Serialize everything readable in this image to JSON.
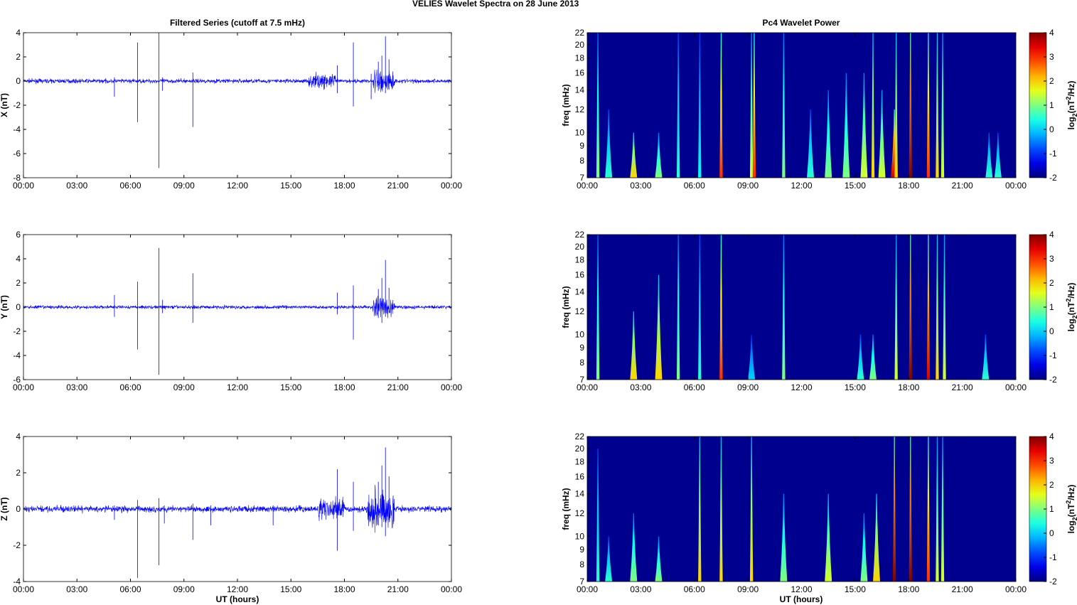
{
  "title": "VELIES Wavelet Spectra on 28 June      2013",
  "colors": {
    "series": "#0000ff",
    "background": "#00008f"
  },
  "chart_data": [
    {
      "type": "line",
      "title": "Filtered Series (cutoff at 7.5 mHz)",
      "panels": [
        {
          "ylabel": "X (nT)",
          "ylim": [
            -8,
            4
          ],
          "yticks": [
            -8,
            -6,
            -4,
            -2,
            0,
            2,
            4
          ],
          "noise": 0.12,
          "spikes": [
            [
              5.1,
              0.3,
              -1.3
            ],
            [
              6.4,
              3.2,
              -3.4
            ],
            [
              7.6,
              4.0,
              -7.2
            ],
            [
              7.8,
              0.3,
              -0.8
            ],
            [
              9.5,
              0.7,
              -3.8
            ],
            [
              17.6,
              1.3,
              -1.0
            ],
            [
              18.5,
              3.2,
              -2.1
            ],
            [
              19.5,
              0.6,
              -1.5
            ],
            [
              19.9,
              1.6,
              -0.8
            ],
            [
              20.1,
              2.1,
              -0.6
            ],
            [
              20.3,
              3.7,
              -1.0
            ],
            [
              20.5,
              1.8,
              -0.7
            ]
          ],
          "burst": [
            [
              16.0,
              17.5,
              0.3
            ],
            [
              19.6,
              20.8,
              0.6
            ]
          ]
        },
        {
          "ylabel": "Y (nT)",
          "ylim": [
            -6,
            6
          ],
          "yticks": [
            -6,
            -4,
            -2,
            0,
            2,
            4,
            6
          ],
          "noise": 0.1,
          "spikes": [
            [
              5.1,
              1.0,
              -0.8
            ],
            [
              6.4,
              2.1,
              -3.5
            ],
            [
              7.6,
              4.9,
              -5.6
            ],
            [
              7.8,
              0.6,
              -0.5
            ],
            [
              9.5,
              2.8,
              -1.3
            ],
            [
              17.6,
              1.2,
              -0.6
            ],
            [
              18.5,
              1.8,
              -2.7
            ],
            [
              19.9,
              1.5,
              -0.9
            ],
            [
              20.1,
              2.4,
              -1.3
            ],
            [
              20.3,
              3.9,
              -0.8
            ],
            [
              20.5,
              1.6,
              -0.5
            ]
          ],
          "burst": [
            [
              19.6,
              20.8,
              0.5
            ]
          ]
        },
        {
          "ylabel": "Z (nT)",
          "ylim": [
            -4,
            4
          ],
          "yticks": [
            -4,
            -2,
            0,
            2,
            4
          ],
          "noise": 0.12,
          "spikes": [
            [
              5.1,
              0.2,
              -0.6
            ],
            [
              6.4,
              0.5,
              -3.8
            ],
            [
              7.6,
              0.6,
              -3.1
            ],
            [
              7.9,
              0.2,
              -0.8
            ],
            [
              9.5,
              0.3,
              -1.7
            ],
            [
              10.5,
              0.2,
              -0.9
            ],
            [
              14,
              0.2,
              -0.9
            ],
            [
              17.6,
              2.2,
              -2.3
            ],
            [
              18.5,
              1.5,
              -1.2
            ],
            [
              19.9,
              1.5,
              -0.9
            ],
            [
              20.1,
              2.4,
              -1.0
            ],
            [
              20.3,
              3.4,
              -1.5
            ],
            [
              20.5,
              1.8,
              -0.6
            ]
          ],
          "burst": [
            [
              16.5,
              18.0,
              0.3
            ],
            [
              19.3,
              20.8,
              0.6
            ]
          ]
        }
      ],
      "xlabel": "UT (hours)",
      "xlim": [
        0,
        24
      ],
      "xticks": [
        "00:00",
        "03:00",
        "06:00",
        "09:00",
        "12:00",
        "15:00",
        "18:00",
        "21:00",
        "00:00"
      ]
    },
    {
      "type": "heatmap",
      "title": "Pc4 Wavelet Power",
      "ylabel": "freq (mHz)",
      "ylim": [
        7,
        22
      ],
      "yticks": [
        7,
        8,
        9,
        10,
        12,
        14,
        16,
        18,
        20,
        22
      ],
      "xlabel": "UT (hours)",
      "xticks": [
        "00:00",
        "03:00",
        "06:00",
        "09:00",
        "12:00",
        "15:00",
        "18:00",
        "21:00",
        "00:00"
      ],
      "colorbar": {
        "label": "log2(nT2/Hz)",
        "label_main": "log",
        "label_sub": "2",
        "label_rest": "(nT",
        "label_sup": "2",
        "label_end": "/Hz)",
        "range": [
          -2,
          4
        ],
        "ticks": [
          -2,
          -1,
          0,
          1,
          2,
          3,
          4
        ]
      },
      "panels": [
        {
          "component": "X",
          "bursts": [
            [
              0.6,
              1,
              22
            ],
            [
              1.2,
              0.5,
              12
            ],
            [
              2.6,
              2,
              10
            ],
            [
              4.0,
              1,
              10
            ],
            [
              5.1,
              0.5,
              22
            ],
            [
              6.3,
              0.3,
              22
            ],
            [
              7.5,
              3,
              22
            ],
            [
              9.2,
              1.5,
              22
            ],
            [
              9.35,
              3,
              22
            ],
            [
              11.0,
              1,
              22
            ],
            [
              12.5,
              0.5,
              12
            ],
            [
              13.5,
              1,
              14
            ],
            [
              14.5,
              1,
              16
            ],
            [
              15.5,
              1.5,
              16
            ],
            [
              16.0,
              2,
              22
            ],
            [
              16.5,
              1.5,
              14
            ],
            [
              17.2,
              3.5,
              12
            ],
            [
              17.3,
              2,
              22
            ],
            [
              18.1,
              4,
              22
            ],
            [
              19.1,
              3,
              22
            ],
            [
              19.6,
              2,
              22
            ],
            [
              19.9,
              1.5,
              22
            ],
            [
              22.5,
              0.5,
              10
            ],
            [
              23.0,
              0.5,
              10
            ]
          ]
        },
        {
          "component": "Y",
          "bursts": [
            [
              0.6,
              1,
              22
            ],
            [
              2.6,
              2,
              12
            ],
            [
              4.0,
              2,
              16
            ],
            [
              5.1,
              1,
              22
            ],
            [
              6.3,
              0.5,
              22
            ],
            [
              7.5,
              3,
              22
            ],
            [
              9.2,
              0,
              10
            ],
            [
              11.0,
              1,
              22
            ],
            [
              15.3,
              0.5,
              10
            ],
            [
              16.0,
              1,
              10
            ],
            [
              17.3,
              1.5,
              22
            ],
            [
              18.1,
              4,
              22
            ],
            [
              19.1,
              3.5,
              22
            ],
            [
              19.6,
              2,
              22
            ],
            [
              20.0,
              1.5,
              22
            ],
            [
              22.3,
              0.5,
              10
            ]
          ]
        },
        {
          "component": "Z",
          "bursts": [
            [
              0.6,
              0.5,
              20
            ],
            [
              1.2,
              0.5,
              10
            ],
            [
              2.6,
              1,
              12
            ],
            [
              4.0,
              1,
              10
            ],
            [
              6.3,
              2,
              22
            ],
            [
              7.5,
              2,
              22
            ],
            [
              9.2,
              2,
              22
            ],
            [
              11.0,
              1,
              14
            ],
            [
              13.5,
              1.5,
              14
            ],
            [
              15.5,
              1,
              12
            ],
            [
              16.2,
              2,
              14
            ],
            [
              17.2,
              4,
              22
            ],
            [
              18.1,
              4,
              22
            ],
            [
              19.1,
              3,
              22
            ],
            [
              19.6,
              1.5,
              22
            ],
            [
              19.9,
              1.5,
              22
            ]
          ]
        }
      ]
    }
  ]
}
